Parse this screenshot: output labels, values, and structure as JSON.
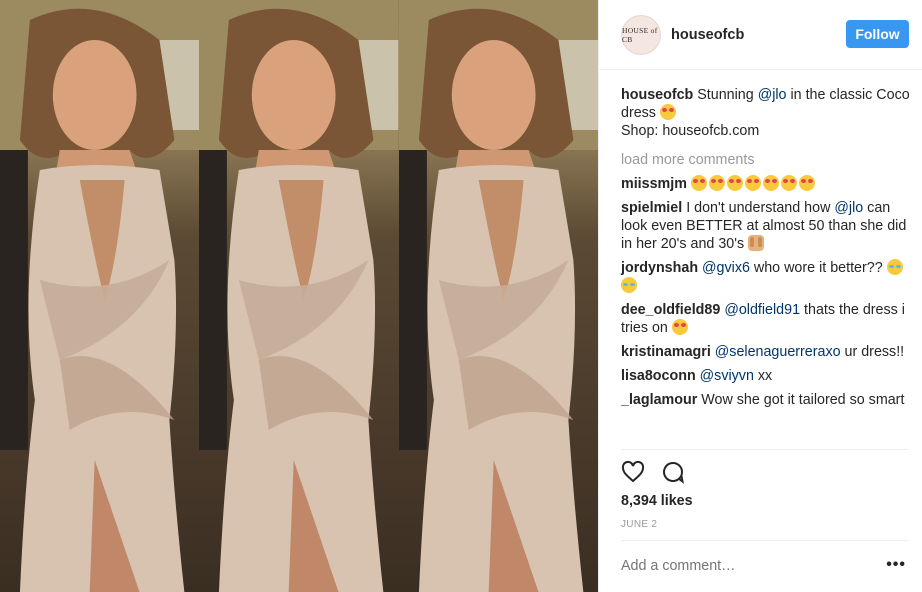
{
  "header": {
    "avatar_text": "HOUSE of CB",
    "username": "houseofcb",
    "follow_label": "Follow"
  },
  "caption": {
    "user": "houseofcb",
    "text_before": "Stunning ",
    "mention": "@jlo",
    "text_after": " in the classic Coco dress",
    "line2": "Shop: houseofcb.com"
  },
  "load_more": "load more comments",
  "comments": [
    {
      "user": "miissmjm",
      "emoji": [
        "heart-eyes-emoji",
        "heart-eyes-emoji",
        "heart-eyes-emoji",
        "heart-eyes-emoji",
        "heart-eyes-emoji",
        "heart-eyes-emoji",
        "heart-eyes-emoji"
      ]
    },
    {
      "user": "spielmiel",
      "text_before": "I don't understand how ",
      "mention": "@jlo",
      "text_after": " can look even BETTER at almost 50 than she did in her 20's and 30's",
      "emoji": [
        "raised-hands-emoji"
      ]
    },
    {
      "user": "jordynshah",
      "mention": "@gvix6",
      "text_after": " who wore it better??",
      "emoji": [
        "laughing-emoji",
        "laughing-emoji"
      ]
    },
    {
      "user": "dee_oldfield89",
      "mention": "@oldfield91",
      "text_after": " thats the dress i tries on",
      "emoji": [
        "heart-eyes-emoji"
      ]
    },
    {
      "user": "kristinamagri",
      "mention": "@selenaguerreraxo",
      "text_after": " ur dress!!"
    },
    {
      "user": "lisa8oconn",
      "mention": "@sviyvn",
      "text_after": " xx"
    },
    {
      "user": "_laglamour",
      "text_after": "Wow she got it tailored so smart"
    }
  ],
  "actions": {
    "like_icon": "heart-icon",
    "comment_icon": "comment-icon"
  },
  "likes": "8,394 likes",
  "date": "JUNE 2",
  "add_comment_placeholder": "Add a comment…",
  "more_options": "•••",
  "colors": {
    "follow_button": "#3897f0",
    "mention": "#003569",
    "muted": "#999999"
  }
}
